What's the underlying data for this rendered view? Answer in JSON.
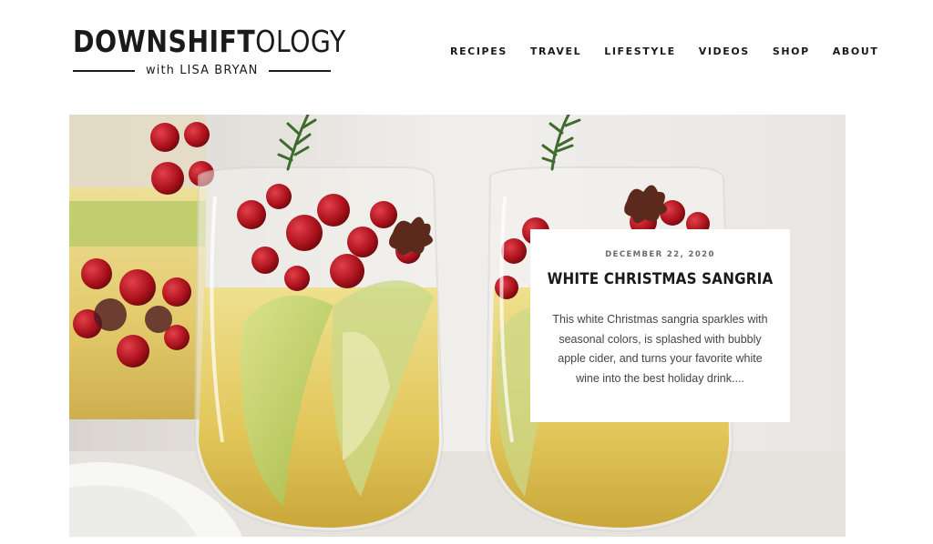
{
  "site": {
    "logo_bold": "DOWNSHIFT",
    "logo_thin": "OLOGY",
    "tagline": "with LISA BRYAN"
  },
  "nav": {
    "items": [
      "RECIPES",
      "TRAVEL",
      "LIFESTYLE",
      "VIDEOS",
      "SHOP",
      "ABOUT"
    ]
  },
  "featured": {
    "date": "DECEMBER 22, 2020",
    "title": "WHITE CHRISTMAS SANGRIA",
    "excerpt": "This white Christmas sangria sparkles with seasonal colors, is splashed with bubbly apple cider, and turns your favorite white wine into the best holiday drink...."
  },
  "colors": {
    "text": "#1a1a1a",
    "card_bg": "#ffffff",
    "sangria": "#e8cf6a",
    "cranberry": "#b3121b",
    "rosemary": "#3f6b2e"
  }
}
